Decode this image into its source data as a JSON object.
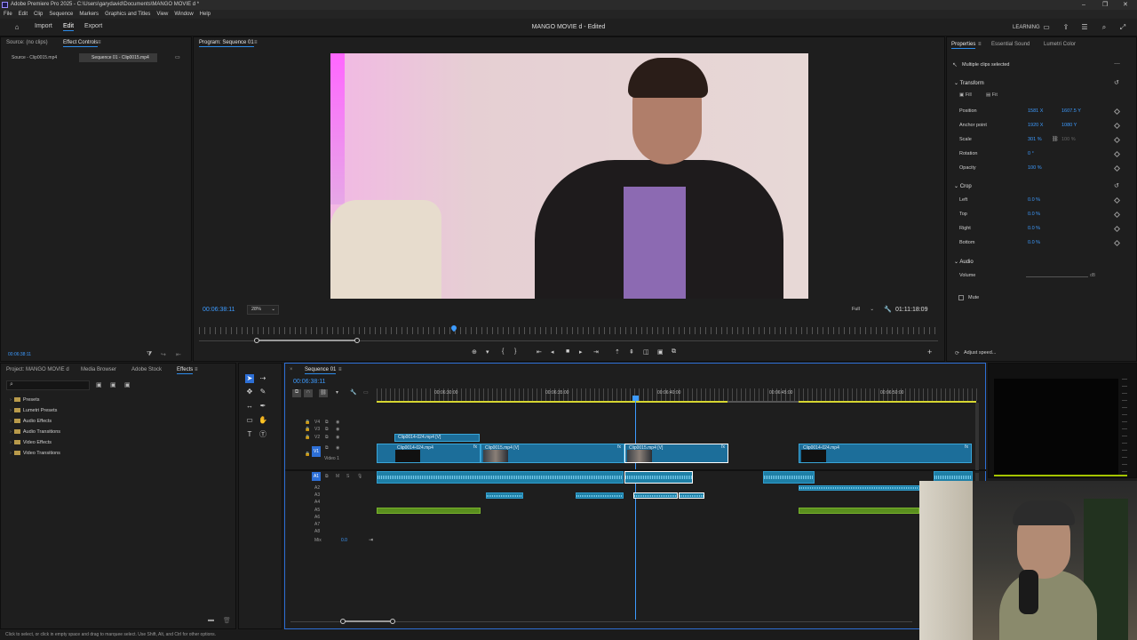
{
  "window": {
    "title": "Adobe Premiere Pro 2025 - C:\\Users\\garydavid\\Documents\\MANGO MOVIE d *",
    "controls": [
      "–",
      "❐",
      "✕"
    ]
  },
  "menu": [
    "File",
    "Edit",
    "Clip",
    "Sequence",
    "Markers",
    "Graphics and Titles",
    "View",
    "Window",
    "Help"
  ],
  "workspace": {
    "home_icon": "home-icon",
    "tabs": [
      {
        "label": "Import"
      },
      {
        "label": "Edit"
      },
      {
        "label": "Export"
      }
    ],
    "active_tab": "Edit",
    "doc_title": "MANGO MOVIE d  - Edited",
    "learning": "LEARNING"
  },
  "source_panel": {
    "tabs": [
      {
        "label": "Source: (no clips)"
      },
      {
        "label": "Effect Controls"
      }
    ],
    "clip_tabs": [
      {
        "label": "Source - Clip0015.mp4"
      },
      {
        "label": "Sequence 01 - Clip0015.mp4"
      }
    ],
    "timecode": "00:06:38:11"
  },
  "program": {
    "title": "Program: Sequence 01",
    "timecode": "00:06:38:11",
    "zoom": "28%",
    "quality": "Full",
    "duration": "01:11:18:09"
  },
  "properties": {
    "tabs": [
      {
        "label": "Properties"
      },
      {
        "label": "Essential Sound"
      },
      {
        "label": "Lumetri Color"
      }
    ],
    "header": "Multiple clips selected",
    "transform": {
      "title": "Transform",
      "fill": "Fill",
      "fit": "Fit",
      "position_label": "Position",
      "position_x": "1581 X",
      "position_y": "1607.5 Y",
      "anchor_label": "Anchor point",
      "anchor_x": "1920 X",
      "anchor_y": "1080 Y",
      "scale_label": "Scale",
      "scale_val": "301 %",
      "scale_val2": "100 %",
      "rotation_label": "Rotation",
      "rotation_val": "0 °",
      "opacity_label": "Opacity",
      "opacity_val": "100 %"
    },
    "crop": {
      "title": "Crop",
      "rows": [
        {
          "label": "Left",
          "val": "0.0 %"
        },
        {
          "label": "Top",
          "val": "0.0 %"
        },
        {
          "label": "Right",
          "val": "0.0 %"
        },
        {
          "label": "Bottom",
          "val": "0.0 %"
        }
      ]
    },
    "audio": {
      "title": "Audio",
      "volume_label": "Volume",
      "volume_unit": "dB",
      "mute_label": "Mute"
    },
    "adjust_speed": "Adjust speed..."
  },
  "project_panel": {
    "tabs": [
      {
        "label": "Project: MANGO MOVIE d"
      },
      {
        "label": "Media Browser"
      },
      {
        "label": "Adobe Stock"
      },
      {
        "label": "Effects"
      }
    ],
    "tree": [
      "Presets",
      "Lumetri Presets",
      "Audio Effects",
      "Audio Transitions",
      "Video Effects",
      "Video Transitions"
    ]
  },
  "timeline": {
    "tab": "Sequence 01",
    "timecode": "00:06:38:11",
    "ruler": [
      "00:06:30:00",
      "00:06:35:00",
      "00:06:40:00",
      "00:06:45:00",
      "00:06:50:00"
    ],
    "video_tracks": [
      "V4",
      "V3",
      "V2",
      "V1"
    ],
    "v1_name": "Video 1",
    "audio_tracks": [
      "A1",
      "A2",
      "A3",
      "A4",
      "A5",
      "A6",
      "A7",
      "A8"
    ],
    "mix_label": "Mix",
    "mix_val": "0.0",
    "clips": {
      "v2_a": "Clip0014-024.mp4 [V]",
      "v1_a": "Clip0014-024.mp4",
      "v1_b": "Clip0015.mp4 [V]",
      "v1_c": "Clip0015.mp4 [V]",
      "v1_d": "Clip0014-024.mp4",
      "fx": "fx"
    }
  },
  "status_bar": "Click to select, or click in empty space and drag to marquee select. Use Shift, Alt, and Ctrl for other options."
}
